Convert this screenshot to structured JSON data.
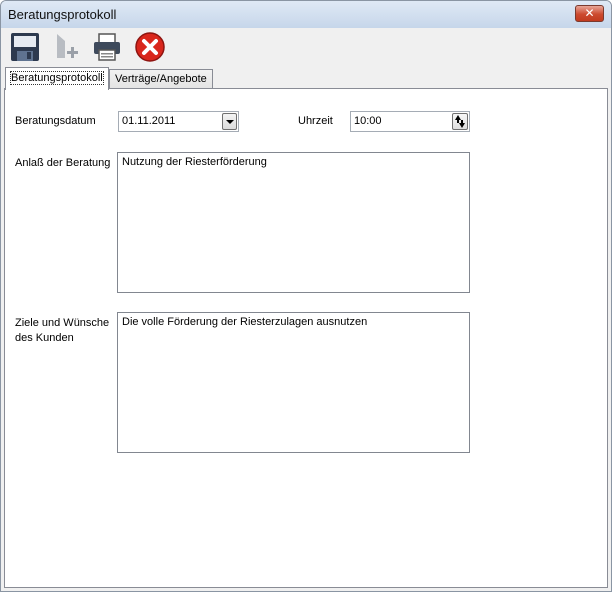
{
  "window": {
    "title": "Beratungsprotokoll",
    "close_label": "✕"
  },
  "toolbar": {
    "save_icon": "floppy-disk-icon",
    "add_icon": "add-document-icon",
    "print_icon": "printer-icon",
    "cancel_icon": "cancel-icon"
  },
  "tabs": [
    {
      "label": "Beratungsprotokoll",
      "active": true
    },
    {
      "label": "Verträge/Angebote",
      "active": false
    }
  ],
  "form": {
    "date_label": "Beratungsdatum",
    "date_value": "01.11.2011",
    "time_label": "Uhrzeit",
    "time_value": "10:00",
    "reason_label": "Anlaß der Beratung",
    "reason_value": "Nutzung der Riesterförderung",
    "goals_label_line1": "Ziele und Wünsche",
    "goals_label_line2": "des Kunden",
    "goals_value": "Die volle Förderung der Riesterzulagen ausnutzen"
  },
  "colors": {
    "cancel_red": "#d9261c",
    "title_gradient_top": "#dfe9f5"
  }
}
